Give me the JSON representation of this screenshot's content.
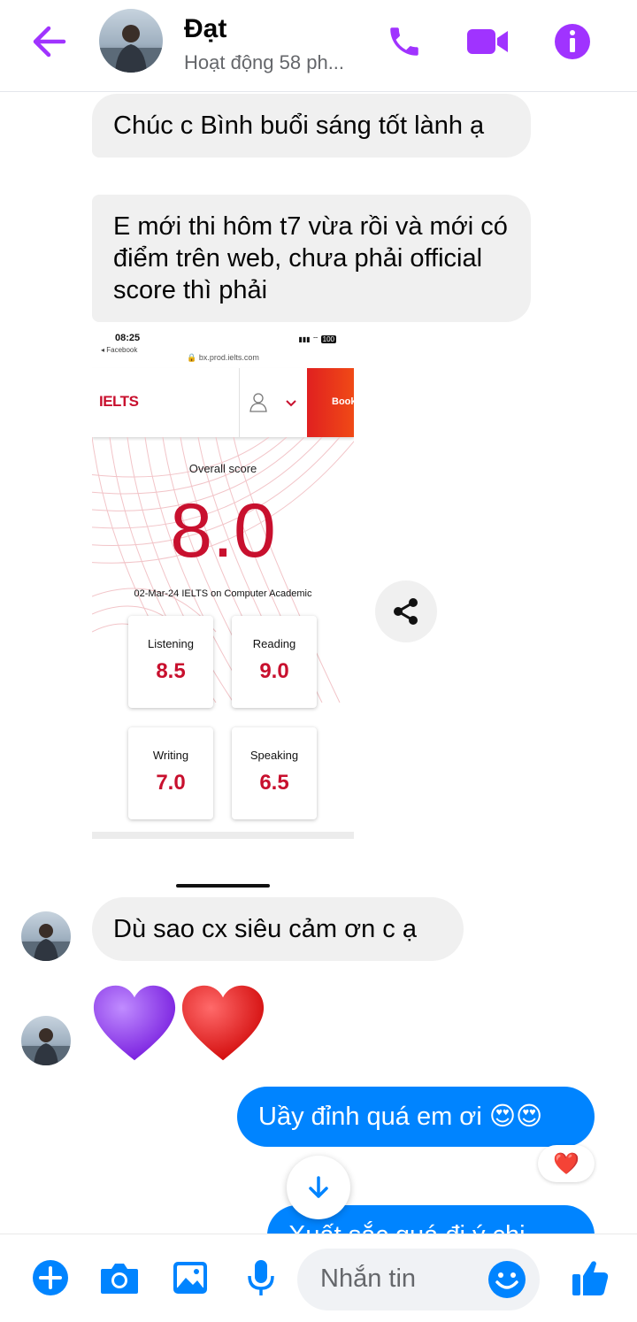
{
  "header": {
    "contact_name": "Đạt",
    "status": "Hoạt động 58 ph...",
    "icons": [
      "back-arrow-icon",
      "phone-icon",
      "video-camera-icon",
      "info-icon"
    ]
  },
  "messages": {
    "m1": "Chúc c Bình buổi sáng tốt lành ạ",
    "m2": "E mới thi hôm t7 vừa rồi và mới có điểm trên web, chưa phải official score thì phải",
    "m3": "Dù sao cx siêu cảm ơn c ạ",
    "m4": "Uầy đỉnh quá em ơi 😍😍",
    "m5": "Xuất sắc quá đi ý chị"
  },
  "hearts": [
    "💜",
    "❤️"
  ],
  "reaction": "❤️",
  "shared_image": {
    "status_time": "08:25",
    "status_app": "◂ Facebook",
    "status_battery": "100",
    "url": "🔒 bx.prod.ielts.com",
    "logo": "IELTS",
    "book_label": "Book",
    "overall_label": "Overall score",
    "overall_score": "8.0",
    "test_info": "02-Mar-24 IELTS on Computer Academic",
    "scores": [
      {
        "label": "Listening",
        "value": "8.5"
      },
      {
        "label": "Reading",
        "value": "9.0"
      },
      {
        "label": "Writing",
        "value": "7.0"
      },
      {
        "label": "Speaking",
        "value": "6.5"
      }
    ]
  },
  "composer": {
    "placeholder": "Nhắn tin",
    "icons": [
      "plus-icon",
      "camera-icon",
      "gallery-icon",
      "microphone-icon",
      "emoji-icon",
      "thumbs-up-icon"
    ]
  },
  "colors": {
    "accent_purple": "#a033ff",
    "blue": "#0084ff",
    "ielts_red": "#c8102e",
    "bubble_gray": "#f0f0f0"
  }
}
